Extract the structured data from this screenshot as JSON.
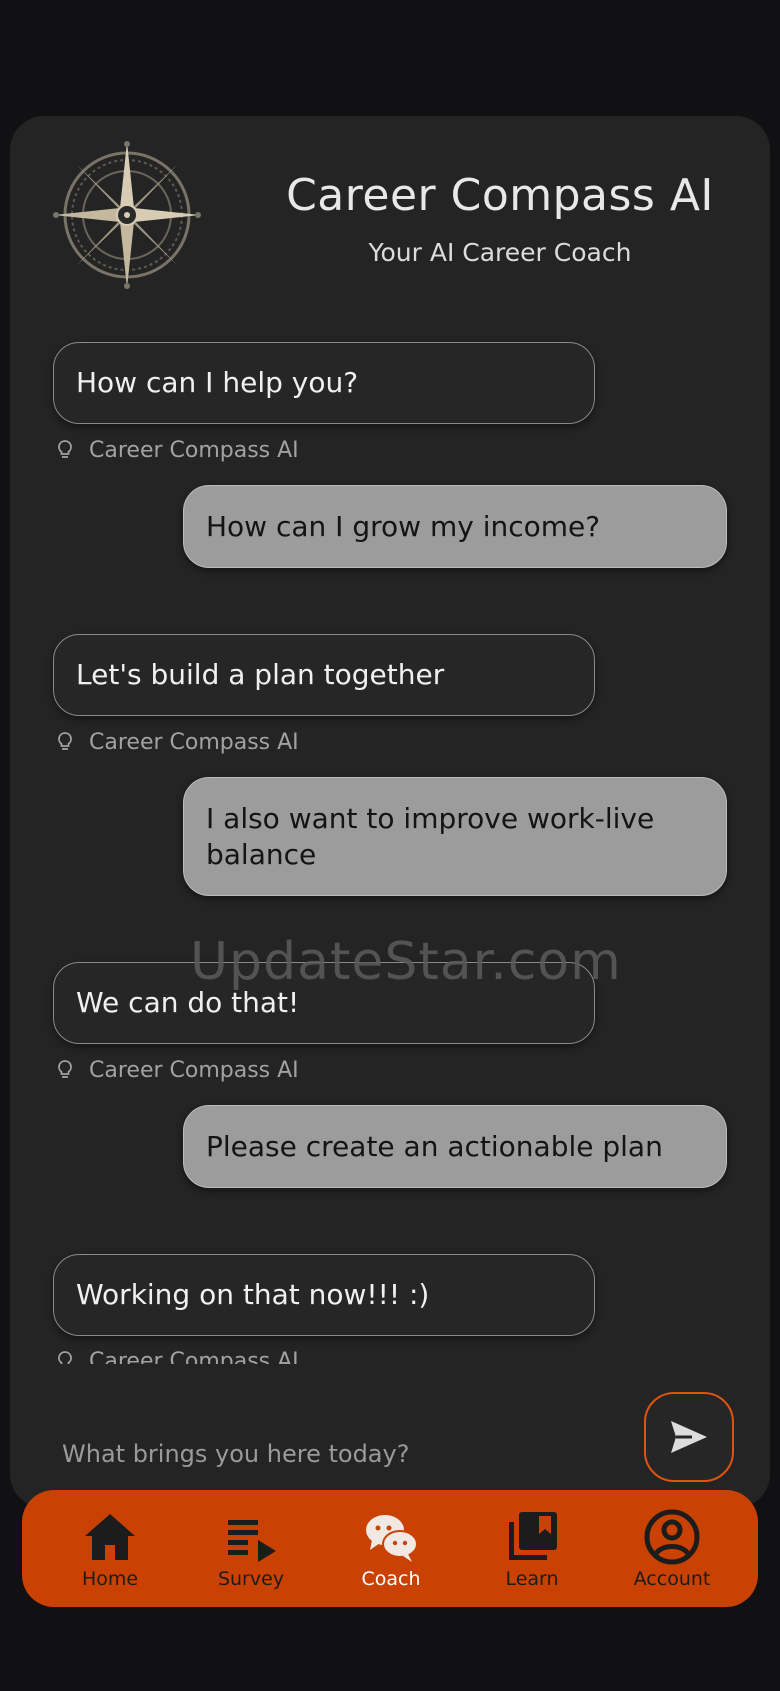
{
  "header": {
    "title": "Career Compass AI",
    "subtitle": "Your AI Career Coach",
    "logo_icon": "compass-rose-icon"
  },
  "messages": [
    {
      "role": "bot",
      "text": "How can I help you?",
      "sender": "Career Compass AI"
    },
    {
      "role": "user",
      "text": "How can I grow my income?"
    },
    {
      "role": "bot",
      "text": "Let's build a plan together",
      "sender": "Career Compass AI"
    },
    {
      "role": "user",
      "text": "I also want to improve work-live balance"
    },
    {
      "role": "bot",
      "text": "We can do that!",
      "sender": "Career Compass AI"
    },
    {
      "role": "user",
      "text": "Please create an actionable plan"
    },
    {
      "role": "bot",
      "text": "Working on that now!!! :)",
      "sender": "Career Compass AI"
    }
  ],
  "watermark": "UpdateStar.com",
  "composer": {
    "placeholder": "What brings you here today?",
    "send_icon": "send-icon"
  },
  "nav": {
    "items": [
      {
        "label": "Home",
        "icon": "home-icon"
      },
      {
        "label": "Survey",
        "icon": "survey-list-icon"
      },
      {
        "label": "Coach",
        "icon": "chat-bubbles-icon",
        "active": true
      },
      {
        "label": "Learn",
        "icon": "library-books-icon"
      },
      {
        "label": "Account",
        "icon": "account-circle-icon"
      }
    ]
  },
  "colors": {
    "background": "#111113",
    "card": "#242424",
    "accent": "#c94203",
    "user_bubble": "#9c9c9c",
    "bot_bubble_border": "#8a8a8a"
  }
}
